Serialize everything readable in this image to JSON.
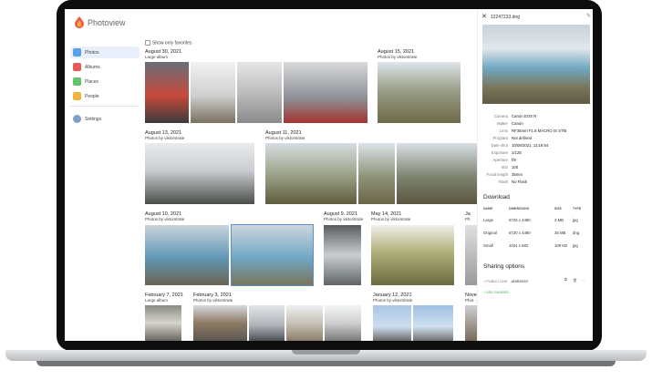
{
  "app": {
    "title": "Photoview"
  },
  "sidebar": {
    "items": [
      {
        "label": "Photos",
        "icon": "photos-icon",
        "color": "#5aa0e8"
      },
      {
        "label": "Albums",
        "icon": "albums-icon",
        "color": "#e85a5a"
      },
      {
        "label": "Places",
        "icon": "places-icon",
        "color": "#5fc46b"
      },
      {
        "label": "People",
        "icon": "people-icon",
        "color": "#f2b33d"
      }
    ],
    "settings": {
      "label": "Settings",
      "icon": "settings-icon",
      "color": "#7f9fc7"
    }
  },
  "filters": {
    "favorites_label": "Show only favorites"
  },
  "timeline": [
    {
      "date": "August 30, 2021",
      "album": "Large album"
    },
    {
      "date": "August 15, 2021",
      "album": "Photos by viktorstrate"
    },
    {
      "date": "August 13, 2021",
      "album": "Photos by viktorstrate"
    },
    {
      "date": "August 11, 2021",
      "album": "Photos by viktorstrate"
    },
    {
      "date": "August 10, 2021",
      "album": "Photos by viktorstrate"
    },
    {
      "date": "August 9, 2021",
      "album": "Photos by viktorstrate"
    },
    {
      "date": "May 14, 2021",
      "album": "Photos by viktorstrate"
    },
    {
      "date": "Ja",
      "album": "Ph"
    },
    {
      "date": "February 7, 2021",
      "album": "Large album"
    },
    {
      "date": "February 3, 2021",
      "album": "Photos by viktorstrate"
    },
    {
      "date": "January 12, 2021",
      "album": "Photos by viktorstrate"
    },
    {
      "date": "Nove",
      "album": "Phot"
    }
  ],
  "detail": {
    "filename": "12247233.dng",
    "exif": [
      {
        "key": "Camera",
        "value": "Canon EOS R"
      },
      {
        "key": "Maker",
        "value": "Canon"
      },
      {
        "key": "Lens",
        "value": "RF35mm F1.8 MACRO IS STM"
      },
      {
        "key": "Program",
        "value": "Not defined"
      },
      {
        "key": "Date shot",
        "value": "10/08/2021, 11:19:54"
      },
      {
        "key": "Exposure",
        "value": "1/125"
      },
      {
        "key": "Aperture",
        "value": "f/8"
      },
      {
        "key": "ISO",
        "value": "100"
      },
      {
        "key": "Focal length",
        "value": "35mm"
      },
      {
        "key": "Flash",
        "value": "No Flash"
      }
    ],
    "download": {
      "title": "Download",
      "columns": [
        "NAME",
        "DIMENSIONS",
        "SIZE",
        "TYPE"
      ],
      "rows": [
        [
          "Large",
          "6720 x 4480",
          "3 MB",
          "jpg"
        ],
        [
          "Original",
          "6720 x 4480",
          "35 MB",
          "dng"
        ],
        [
          "Small",
          "1024 x 682",
          "109 KB",
          "jpg"
        ]
      ]
    },
    "sharing": {
      "title": "Sharing options",
      "public_link_label": "PUBLIC LINK",
      "token": "zE0BX9JG",
      "add_label": "ADD SHARES"
    }
  },
  "colors": {
    "accent": "#5aa0e8",
    "selection": "#5a8fc8",
    "link": "#3aa94b"
  }
}
